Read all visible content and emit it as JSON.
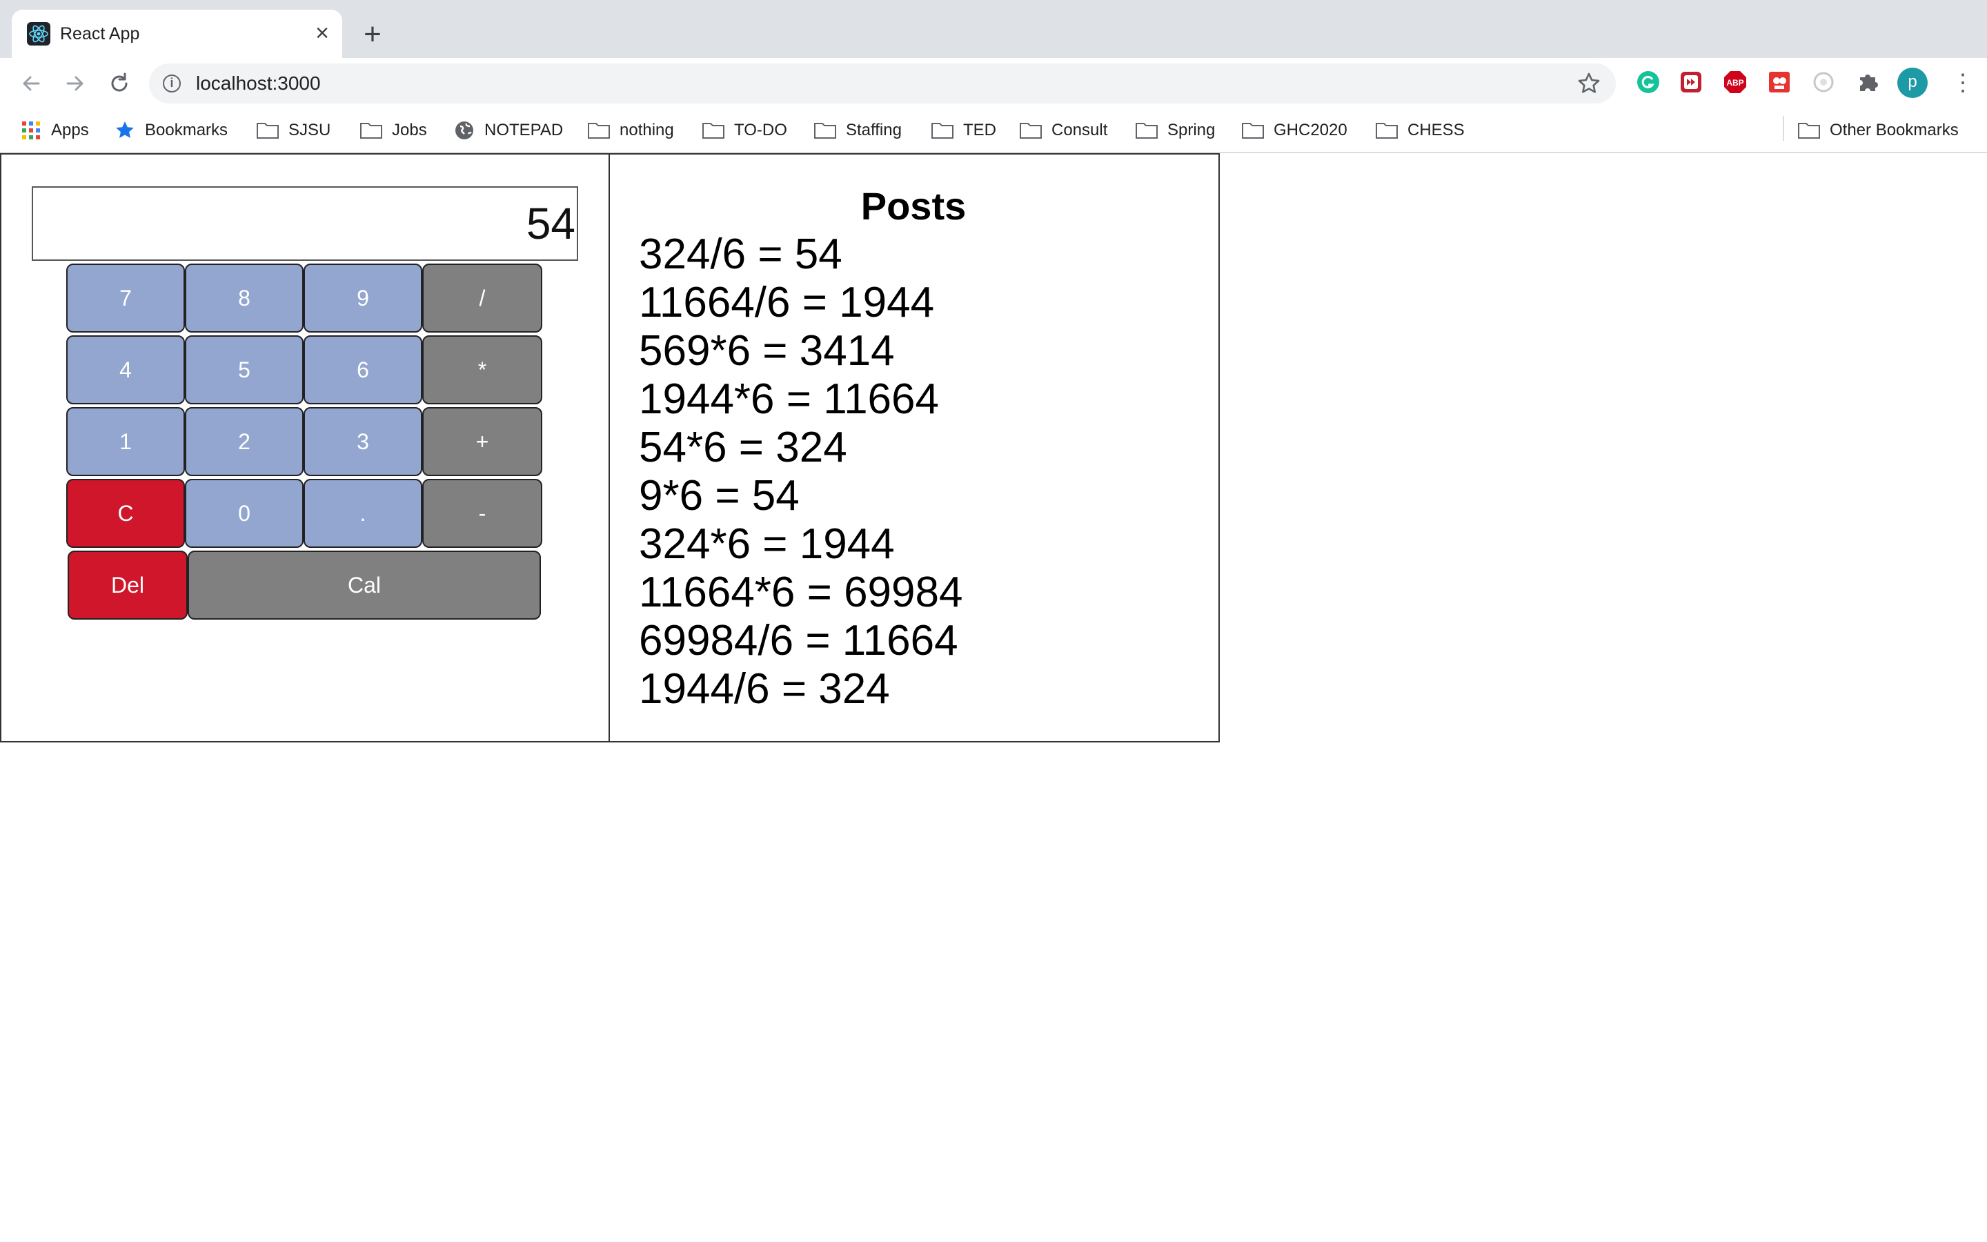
{
  "browser": {
    "tab_title": "React App",
    "tab_close": "×",
    "new_tab": "+",
    "url": "localhost:3000",
    "profile_initial": "p",
    "extensions": [
      {
        "name": "grammarly-icon",
        "color": "#15c39a"
      },
      {
        "name": "media-extension-icon",
        "color": "#c0202f"
      },
      {
        "name": "adblock-plus-icon",
        "color": "#d0021b"
      },
      {
        "name": "red-extension-icon",
        "color": "#e5332f"
      },
      {
        "name": "gray-extension-icon",
        "color": "#c8c8c8"
      }
    ],
    "bookmarks": [
      {
        "label": "Apps",
        "icon": "apps-grid-icon"
      },
      {
        "label": "Bookmarks",
        "icon": "star-icon"
      },
      {
        "label": "SJSU",
        "icon": "folder-icon"
      },
      {
        "label": "Jobs",
        "icon": "folder-icon"
      },
      {
        "label": "NOTEPAD",
        "icon": "globe-icon"
      },
      {
        "label": "nothing",
        "icon": "folder-icon"
      },
      {
        "label": "TO-DO",
        "icon": "folder-icon"
      },
      {
        "label": "Staffing",
        "icon": "folder-icon"
      },
      {
        "label": "TED",
        "icon": "folder-icon"
      },
      {
        "label": "Consult",
        "icon": "folder-icon"
      },
      {
        "label": "Spring",
        "icon": "folder-icon"
      },
      {
        "label": "GHC2020",
        "icon": "folder-icon"
      },
      {
        "label": "CHESS",
        "icon": "folder-icon"
      }
    ],
    "other_bookmarks": "Other Bookmarks"
  },
  "calculator": {
    "display_value": "54",
    "keys": [
      {
        "label": "7",
        "type": "num"
      },
      {
        "label": "8",
        "type": "num"
      },
      {
        "label": "9",
        "type": "num"
      },
      {
        "label": "/",
        "type": "op"
      },
      {
        "label": "4",
        "type": "num"
      },
      {
        "label": "5",
        "type": "num"
      },
      {
        "label": "6",
        "type": "num"
      },
      {
        "label": "*",
        "type": "op"
      },
      {
        "label": "1",
        "type": "num"
      },
      {
        "label": "2",
        "type": "num"
      },
      {
        "label": "3",
        "type": "num"
      },
      {
        "label": "+",
        "type": "op"
      },
      {
        "label": "C",
        "type": "red"
      },
      {
        "label": "0",
        "type": "num"
      },
      {
        "label": ".",
        "type": "num"
      },
      {
        "label": "-",
        "type": "op"
      },
      {
        "label": "Del",
        "type": "red"
      },
      {
        "label": "Cal",
        "type": "op"
      }
    ],
    "colors": {
      "number_key": "#93a6cf",
      "operator_key": "#808080",
      "clear_key": "#d0162a"
    }
  },
  "posts": {
    "title": "Posts",
    "items": [
      "324/6 = 54",
      "11664/6 = 1944",
      "569*6 = 3414",
      "1944*6 = 11664",
      "54*6 = 324",
      "9*6 = 54",
      "324*6 = 1944",
      "11664*6 = 69984",
      "69984/6 = 11664",
      "1944/6 = 324"
    ]
  }
}
